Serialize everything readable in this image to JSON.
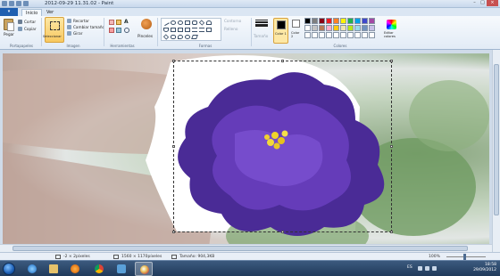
{
  "window": {
    "title": "2012-09-29 11.31.02 - Paint",
    "buttons": [
      "–",
      "□",
      "×"
    ]
  },
  "ribbon_tabs": {
    "file": "▾",
    "items": [
      "Inicio",
      "Ver"
    ],
    "active": "Inicio"
  },
  "groups": {
    "portapapeles": {
      "label": "Portapapeles",
      "paste": "Pegar",
      "cut": "Cortar",
      "copy": "Copiar"
    },
    "imagen": {
      "label": "Imagen",
      "select": "Seleccionar",
      "crop": "Recortar",
      "resize": "Cambiar tamaño",
      "rotate": "Girar"
    },
    "herramientas": {
      "label": "Herramientas",
      "text_tool": "A"
    },
    "pinceles": {
      "label": "Pinceles"
    },
    "formas": {
      "label": "Formas",
      "outline": "Contorno",
      "fill": "Relleno"
    },
    "tamano": {
      "label": "Tamaño"
    },
    "colores": {
      "label": "Colores",
      "color1": "Color 1",
      "color2": "Color 2",
      "edit": "Editar colores",
      "color1_value": "#000000",
      "color2_value": "#ffffff",
      "palette": [
        "#000000",
        "#7f7f7f",
        "#880015",
        "#ed1c24",
        "#ff7f27",
        "#fff200",
        "#22b14c",
        "#00a2e8",
        "#3f48cc",
        "#a349a4",
        "#ffffff",
        "#c3c3c3",
        "#b97a57",
        "#ffaec9",
        "#ffc90e",
        "#efe4b0",
        "#b5e61d",
        "#99d9ea",
        "#7092be",
        "#c8bfe7",
        "#ffffff",
        "#ffffff",
        "#ffffff",
        "#ffffff",
        "#ffffff",
        "#ffffff",
        "#ffffff",
        "#ffffff",
        "#ffffff",
        "#ffffff"
      ]
    }
  },
  "status": {
    "cursor": "-2 × 2píxeles",
    "selection_size": "1560 × 1170píxeles",
    "file_size": "Tamaño: 904,3KB",
    "zoom": "100%"
  },
  "taskbar": {
    "lang": "ES",
    "time": "18:58",
    "date": "29/09/2012"
  },
  "icons": {
    "start": "windows-orb-icon",
    "apps": [
      "internet-explorer-icon",
      "file-explorer-icon",
      "media-player-icon",
      "chrome-icon",
      "photo-viewer-icon",
      "paint-icon"
    ]
  }
}
